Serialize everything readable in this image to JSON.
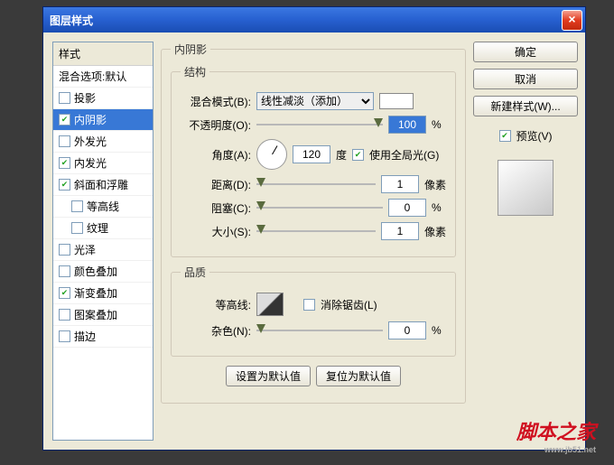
{
  "title": "图层样式",
  "styles": {
    "header": "样式",
    "items": [
      {
        "label": "混合选项:默认",
        "chk": null
      },
      {
        "label": "投影",
        "chk": false
      },
      {
        "label": "内阴影",
        "chk": true,
        "selected": true
      },
      {
        "label": "外发光",
        "chk": false
      },
      {
        "label": "内发光",
        "chk": true
      },
      {
        "label": "斜面和浮雕",
        "chk": true
      },
      {
        "label": "等高线",
        "chk": false,
        "sub": true
      },
      {
        "label": "纹理",
        "chk": false,
        "sub": true
      },
      {
        "label": "光泽",
        "chk": false
      },
      {
        "label": "颜色叠加",
        "chk": false
      },
      {
        "label": "渐变叠加",
        "chk": true
      },
      {
        "label": "图案叠加",
        "chk": false
      },
      {
        "label": "描边",
        "chk": false
      }
    ]
  },
  "panel": {
    "title": "内阴影",
    "structure": {
      "title": "结构",
      "blend_label": "混合模式(B):",
      "blend_value": "线性减淡（添加）",
      "opacity_label": "不透明度(O):",
      "opacity_value": "100",
      "opacity_unit": "%",
      "angle_label": "角度(A):",
      "angle_value": "120",
      "angle_unit": "度",
      "global_label": "使用全局光(G)",
      "global_on": true,
      "distance_label": "距离(D):",
      "distance_value": "1",
      "distance_unit": "像素",
      "choke_label": "阻塞(C):",
      "choke_value": "0",
      "choke_unit": "%",
      "size_label": "大小(S):",
      "size_value": "1",
      "size_unit": "像素"
    },
    "quality": {
      "title": "品质",
      "contour_label": "等高线:",
      "antialias_label": "消除锯齿(L)",
      "antialias_on": false,
      "noise_label": "杂色(N):",
      "noise_value": "0",
      "noise_unit": "%"
    },
    "btn_default": "设置为默认值",
    "btn_reset": "复位为默认值"
  },
  "right": {
    "ok": "确定",
    "cancel": "取消",
    "newstyle": "新建样式(W)...",
    "preview_label": "预览(V)",
    "preview_on": true
  },
  "watermark": {
    "text": "脚本之家",
    "url": "www.jb51.net"
  }
}
